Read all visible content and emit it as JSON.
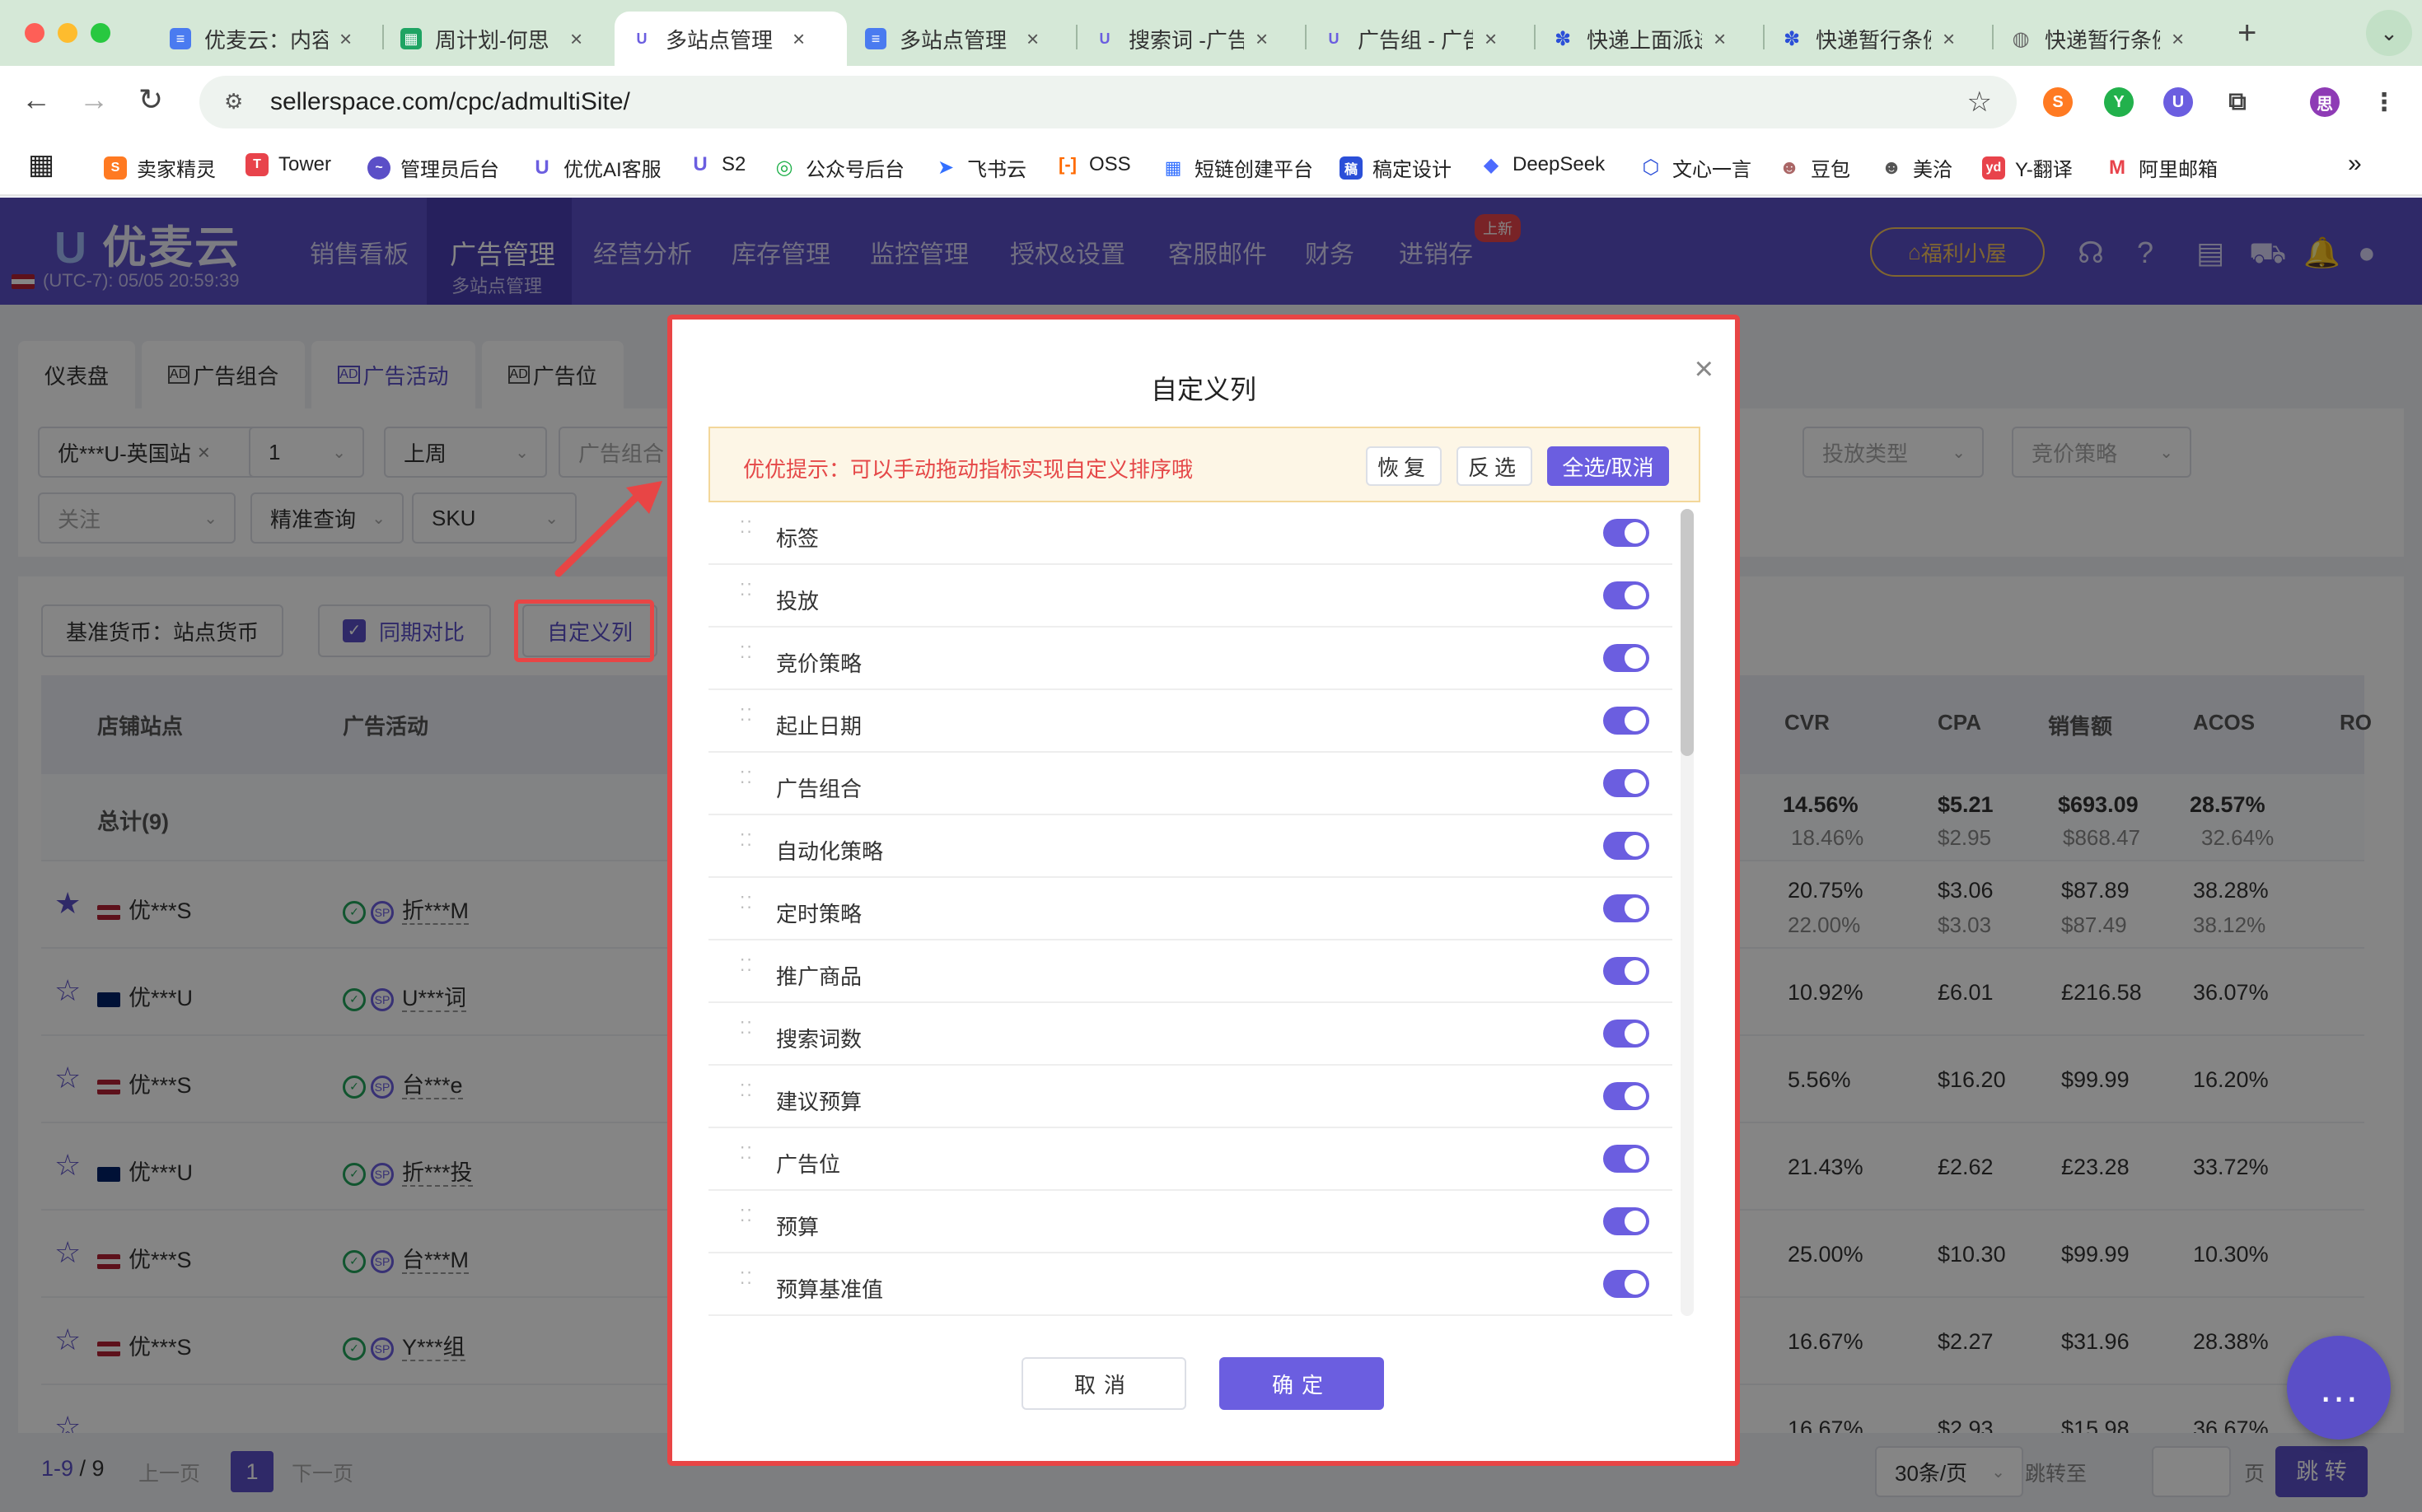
{
  "browser": {
    "tabs": [
      {
        "title": "优麦云：内容",
        "icon": "doc"
      },
      {
        "title": "周计划-何思",
        "icon": "sheet"
      },
      {
        "title": "多站点管理",
        "icon": "u",
        "active": true
      },
      {
        "title": "多站点管理",
        "icon": "doc"
      },
      {
        "title": "搜索词 -广告",
        "icon": "u"
      },
      {
        "title": "广告组 - 广告",
        "icon": "u"
      },
      {
        "title": "快递上面派送",
        "icon": "paw"
      },
      {
        "title": "快递暂行条例",
        "icon": "paw"
      },
      {
        "title": "快递暂行条例",
        "icon": "globe"
      }
    ],
    "url": "sellerspace.com/cpc/admultiSite/",
    "bookmarks": [
      "卖家精灵",
      "Tower",
      "管理员后台",
      "优优AI客服",
      "S2",
      "公众号后台",
      "飞书云",
      "OSS",
      "短链创建平台",
      "稿定设计",
      "DeepSeek",
      "文心一言",
      "豆包",
      "美洽",
      "Y-翻译",
      "阿里邮箱"
    ]
  },
  "app": {
    "logo": "优麦云",
    "clock": "(UTC-7): 05/05 20:59:39",
    "nav": [
      "销售看板",
      "广告管理",
      "经营分析",
      "库存管理",
      "监控管理",
      "授权&设置",
      "客服邮件",
      "财务",
      "进销存"
    ],
    "nav_active_sub": "多站点管理",
    "new_badge": "上新",
    "welfare": "福利小屋"
  },
  "page": {
    "subtabs": [
      "仪表盘",
      "广告组合",
      "广告活动",
      "广告位"
    ],
    "filters": {
      "store": "优***U-英国站",
      "store_count": "1",
      "period": "上周",
      "portfolio_ph": "广告组合",
      "attention_ph": "关注",
      "match": "精准查询",
      "sku": "SKU",
      "delivery_type_ph": "投放类型",
      "bid_strategy_ph": "竞价策略"
    },
    "toolbar": {
      "currency": "基准货币：站点货币",
      "compare": "同期对比",
      "custom_cols": "自定义列"
    },
    "table": {
      "headers": {
        "store": "店铺站点",
        "campaign": "广告活动",
        "cvr": "CVR",
        "cpa": "CPA",
        "sales": "销售额",
        "acos": "ACOS",
        "ro": "RO"
      },
      "total_label": "总计(9)",
      "total": {
        "cvr": "14.56%",
        "cvr_prev": "18.46%",
        "cpa": "$5.21",
        "cpa_prev": "$2.95",
        "sales": "$693.09",
        "sales_prev": "$868.47",
        "acos": "28.57%",
        "acos_prev": "32.64%"
      },
      "rows": [
        {
          "store": "优***S",
          "flag": "us",
          "campaign": "折***M",
          "cvr": "20.75%",
          "cvr_prev": "22.00%",
          "cpa": "$3.06",
          "cpa_prev": "$3.03",
          "sales": "$87.89",
          "sales_prev": "$87.49",
          "acos": "38.28%",
          "acos_prev": "38.12%",
          "starred": true
        },
        {
          "store": "优***U",
          "flag": "uk",
          "campaign": "U***词",
          "cvr": "10.92%",
          "cpa": "£6.01",
          "sales": "£216.58",
          "acos": "36.07%"
        },
        {
          "store": "优***S",
          "flag": "us",
          "campaign": "台***e",
          "cvr": "5.56%",
          "cpa": "$16.20",
          "sales": "$99.99",
          "acos": "16.20%"
        },
        {
          "store": "优***U",
          "flag": "uk",
          "campaign": "折***投",
          "cvr": "21.43%",
          "cpa": "£2.62",
          "sales": "£23.28",
          "acos": "33.72%"
        },
        {
          "store": "优***S",
          "flag": "us",
          "campaign": "台***M",
          "cvr": "25.00%",
          "cpa": "$10.30",
          "sales": "$99.99",
          "acos": "10.30%"
        },
        {
          "store": "优***S",
          "flag": "us",
          "campaign": "Y***组",
          "cvr": "16.67%",
          "cpa": "$2.27",
          "sales": "$31.96",
          "acos": "28.38%"
        },
        {
          "store": "",
          "flag": "",
          "campaign": "",
          "cvr": "16.67%",
          "cpa": "$2.93",
          "sales": "$15.98",
          "acos": "36.67%"
        }
      ]
    },
    "pager": {
      "range": "1-9",
      "total": "9",
      "prev": "上一页",
      "page": "1",
      "next": "下一页",
      "size": "30条/页",
      "jump_to": "跳转至",
      "page_unit": "页",
      "go": "跳 转"
    }
  },
  "dialog": {
    "title": "自定义列",
    "tip": "优优提示：可以手动拖动指标实现自定义排序哦",
    "restore": "恢复",
    "invert": "反选",
    "select_all": "全选/取消",
    "columns": [
      {
        "label": "标签",
        "on": true
      },
      {
        "label": "投放",
        "on": true
      },
      {
        "label": "竞价策略",
        "on": true
      },
      {
        "label": "起止日期",
        "on": true
      },
      {
        "label": "广告组合",
        "on": true
      },
      {
        "label": "自动化策略",
        "on": true
      },
      {
        "label": "定时策略",
        "on": true
      },
      {
        "label": "推广商品",
        "on": true
      },
      {
        "label": "搜索词数",
        "on": true
      },
      {
        "label": "建议预算",
        "on": true
      },
      {
        "label": "广告位",
        "on": true
      },
      {
        "label": "预算",
        "on": true
      },
      {
        "label": "预算基准值",
        "on": true
      }
    ],
    "cancel": "取消",
    "confirm": "确定"
  },
  "colors": {
    "brand": "#5b4fc7",
    "accent": "#6b5ee0",
    "annotation": "#e84545",
    "tip_text": "#e54848"
  }
}
